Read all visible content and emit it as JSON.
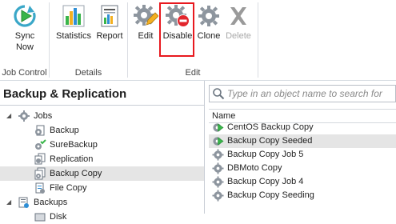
{
  "ribbon": {
    "groups": [
      {
        "title": "Job Control",
        "buttons": [
          {
            "label": "Sync Now"
          }
        ]
      },
      {
        "title": "Details",
        "buttons": [
          {
            "label": "Statistics"
          },
          {
            "label": "Report"
          }
        ]
      },
      {
        "title": "Edit",
        "buttons": [
          {
            "label": "Edit"
          },
          {
            "label": "Disable"
          },
          {
            "label": "Clone"
          },
          {
            "label": "Delete"
          }
        ]
      }
    ],
    "accent_highlight_color": "#e8191f"
  },
  "navigation": {
    "title": "Backup & Replication",
    "tree": [
      {
        "label": "Jobs",
        "icon": "gear-icon",
        "expanded": true
      },
      {
        "label": "Backup",
        "icon": "backup-job-icon"
      },
      {
        "label": "SureBackup",
        "icon": "surebackup-icon"
      },
      {
        "label": "Replication",
        "icon": "replication-icon"
      },
      {
        "label": "Backup Copy",
        "icon": "backup-copy-icon",
        "selected": true
      },
      {
        "label": "File Copy",
        "icon": "file-copy-icon"
      },
      {
        "label": "Backups",
        "icon": "backups-icon",
        "expanded": true
      },
      {
        "label": "Disk",
        "icon": "disk-icon"
      }
    ]
  },
  "content": {
    "search_placeholder": "Type in an object name to search for",
    "column_header": "Name",
    "rows": [
      {
        "name": "CentOS Backup Copy",
        "icon": "job-running-icon"
      },
      {
        "name": "Backup Copy Seeded",
        "icon": "job-running-icon",
        "selected": true
      },
      {
        "name": "Backup Copy Job 5",
        "icon": "job-gear-icon"
      },
      {
        "name": "DBMoto Copy",
        "icon": "job-gear-icon"
      },
      {
        "name": "Backup Copy Job 4",
        "icon": "job-gear-icon"
      },
      {
        "name": "Backup Copy Seeding",
        "icon": "job-gear-icon"
      }
    ]
  }
}
